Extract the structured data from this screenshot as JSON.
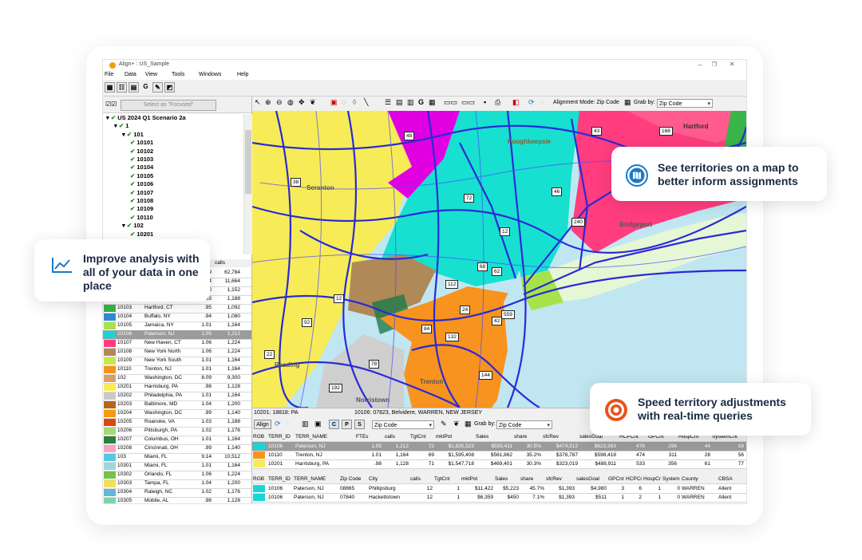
{
  "window": {
    "title": "Align+ : US_Sample",
    "menu": [
      "File",
      "Data",
      "View",
      "Tools",
      "Windows",
      "Help"
    ],
    "controls": [
      "–",
      "❐",
      "✕"
    ]
  },
  "left_panel": {
    "select_focused": "Select as \"Focused\"",
    "tree": [
      {
        "label": "US 2024 Q1 Scenario 2a",
        "level": 0
      },
      {
        "label": "1",
        "level": 1
      },
      {
        "label": "101",
        "level": 2
      },
      {
        "label": "10101",
        "level": 3
      },
      {
        "label": "10102",
        "level": 3
      },
      {
        "label": "10103",
        "level": 3
      },
      {
        "label": "10104",
        "level": 3
      },
      {
        "label": "10105",
        "level": 3
      },
      {
        "label": "10106",
        "level": 3
      },
      {
        "label": "10107",
        "level": 3
      },
      {
        "label": "10108",
        "level": 3
      },
      {
        "label": "10109",
        "level": 3
      },
      {
        "label": "10110",
        "level": 3
      },
      {
        "label": "102",
        "level": 2
      },
      {
        "label": "10201",
        "level": 3
      }
    ],
    "table_header": {
      "calls": "calls"
    },
    "rows": [
      {
        "id": "",
        "name": "",
        "ftes": "9",
        "calls": "62,784",
        "color": "#d8d8d8"
      },
      {
        "id": "",
        "name": "",
        "ftes": "4",
        "calls": "11,664",
        "color": "#d8d8d8"
      },
      {
        "id": "",
        "name": "",
        "ftes": "0",
        "calls": "1,152",
        "color": "#ffffff"
      },
      {
        "id": "",
        "name": "",
        "ftes": "03",
        "calls": "1,188",
        "color": "#ffffff"
      },
      {
        "id": "10103",
        "name": "Hartford, CT",
        "ftes": ".95",
        "calls": "1,092",
        "color": "#39b54a"
      },
      {
        "id": "10104",
        "name": "Buffalo, NY",
        "ftes": ".94",
        "calls": "1,080",
        "color": "#2e8bd0"
      },
      {
        "id": "10105",
        "name": "Jamaica, NY",
        "ftes": "1.01",
        "calls": "1,164",
        "color": "#a6e34a"
      },
      {
        "id": "10106",
        "name": "Paterson, NJ",
        "ftes": "1.05",
        "calls": "1,212",
        "color": "#17d6d6",
        "selected": true
      },
      {
        "id": "10107",
        "name": "New Haven, CT",
        "ftes": "1.06",
        "calls": "1,224",
        "color": "#ff3d7f"
      },
      {
        "id": "10108",
        "name": "New York North",
        "ftes": "1.06",
        "calls": "1,224",
        "color": "#b08958"
      },
      {
        "id": "10109",
        "name": "New York South",
        "ftes": "1.01",
        "calls": "1,164",
        "color": "#c7e84b"
      },
      {
        "id": "10110",
        "name": "Trenton, NJ",
        "ftes": "1.01",
        "calls": "1,164",
        "color": "#f7931e"
      },
      {
        "id": "102",
        "name": "Washington, DC",
        "ftes": "8.09",
        "calls": "9,300",
        "color": "#d9a066"
      },
      {
        "id": "10201",
        "name": "Harrisburg, PA",
        "ftes": ".98",
        "calls": "1,128",
        "color": "#f7ec57"
      },
      {
        "id": "10202",
        "name": "Philadelphia, PA",
        "ftes": "1.01",
        "calls": "1,164",
        "color": "#c9c9c9"
      },
      {
        "id": "10203",
        "name": "Baltimore, MD",
        "ftes": "1.04",
        "calls": "1,200",
        "color": "#b5651d"
      },
      {
        "id": "10204",
        "name": "Washington, DC",
        "ftes": ".99",
        "calls": "1,140",
        "color": "#f39c12"
      },
      {
        "id": "10205",
        "name": "Roanoke, VA",
        "ftes": "1.03",
        "calls": "1,188",
        "color": "#d9480f"
      },
      {
        "id": "10206",
        "name": "Pittsburgh, PA",
        "ftes": "1.02",
        "calls": "1,176",
        "color": "#a3d977"
      },
      {
        "id": "10207",
        "name": "Columbus, OH",
        "ftes": "1.01",
        "calls": "1,164",
        "color": "#2f7d3f"
      },
      {
        "id": "10208",
        "name": "Cincinnati, OH",
        "ftes": ".99",
        "calls": "1,140",
        "color": "#f6a5c0"
      },
      {
        "id": "103",
        "name": "Miami, FL",
        "ftes": "9.14",
        "calls": "10,512",
        "color": "#55c7e0"
      },
      {
        "id": "10301",
        "name": "Miami, FL",
        "ftes": "1.01",
        "calls": "1,164",
        "color": "#9fd7d7"
      },
      {
        "id": "10302",
        "name": "Orlando, FL",
        "ftes": "1.06",
        "calls": "1,224",
        "color": "#76c24a"
      },
      {
        "id": "10303",
        "name": "Tampa, FL",
        "ftes": "1.04",
        "calls": "1,200",
        "color": "#f1e05a"
      },
      {
        "id": "10304",
        "name": "Raleigh, NC",
        "ftes": "1.02",
        "calls": "1,176",
        "color": "#5fb8d8"
      },
      {
        "id": "10305",
        "name": "Mobile, AL",
        "ftes": ".98",
        "calls": "1,128",
        "color": "#7fd3a8"
      }
    ]
  },
  "map_toolbar": {
    "alignment_mode_label": "Alignment Mode: Zip Code",
    "grab_by_label": "Grab by:",
    "grab_by_value": "Zip Code"
  },
  "map": {
    "city_labels": [
      "Poughkeepsie",
      "Hartford",
      "Scranton",
      "Bridgeport",
      "Reading",
      "Trenton",
      "Norristown"
    ],
    "route_labels": [
      "48",
      "38",
      "72",
      "12",
      "68",
      "62",
      "42",
      "240",
      "24",
      "84",
      "132",
      "92",
      "78",
      "192",
      "22",
      "144",
      "559",
      "12",
      "112",
      "168",
      "43",
      "46"
    ]
  },
  "map_status": {
    "left": "10201: 18818: PA",
    "right": "10106: 07823, Belvidere, WARREN, NEW JERSEY"
  },
  "bottom_toolbar": {
    "align_label": "Align",
    "c_label": "C",
    "p_label": "P",
    "s_label": "S",
    "zip_combo": "Zip Code",
    "grab_by_label": "Grab by:",
    "grab_by_value": "Zip Code"
  },
  "terr_grid": {
    "headers": [
      "RGB",
      "TERR_ID",
      "TERR_NAME",
      "FTEs",
      "calls",
      "TgtCnt",
      "mktPot",
      "Sales",
      "share",
      "sfcRev",
      "salesGoal",
      "HCPCnt",
      "GPCnt",
      "HospCnt",
      "SystemCnt"
    ],
    "rows": [
      {
        "color": "#17d6d6",
        "cells": [
          "10106",
          "Paterson, NJ",
          "1.05",
          "1,212",
          "72",
          "$1,835,523",
          "$559,411",
          "30.5%",
          "$474,512",
          "$623,993",
          "476",
          "296",
          "44",
          "59"
        ],
        "selected": true
      },
      {
        "color": "#f7931e",
        "cells": [
          "10110",
          "Trenton, NJ",
          "1.01",
          "1,164",
          "69",
          "$1,595,408",
          "$561,862",
          "35.2%",
          "$378,787",
          "$598,418",
          "474",
          "311",
          "28",
          "56"
        ]
      },
      {
        "color": "#f7ec57",
        "cells": [
          "10201",
          "Harrisburg, PA",
          ".98",
          "1,128",
          "71",
          "$1,547,718",
          "$469,401",
          "30.3%",
          "$323,019",
          "$488,911",
          "533",
          "356",
          "61",
          "77"
        ]
      }
    ]
  },
  "zip_grid": {
    "headers": [
      "RGB",
      "TERR_ID",
      "TERR_NAME",
      "Zip Code",
      "City",
      "calls",
      "TgtCnt",
      "mktPot",
      "Sales",
      "share",
      "sfcRev",
      "salesGoal",
      "GPCnt",
      "HCPCnt",
      "HospCnt",
      "System",
      "County",
      "CBSA"
    ],
    "rows": [
      {
        "color": "#17d6d6",
        "cells": [
          "10106",
          "Paterson, NJ",
          "08865",
          "Phillipsburg",
          "12",
          "1",
          "$11,422",
          "$5,223",
          "45.7%",
          "$1,393",
          "$4,980",
          "3",
          "6",
          "1",
          "0",
          "WARREN",
          "Allent"
        ]
      },
      {
        "color": "#17d6d6",
        "cells": [
          "10106",
          "Paterson, NJ",
          "07840",
          "Hackettstown",
          "12",
          "1",
          "$6,359",
          "$450",
          "7.1%",
          "$1,393",
          "$511",
          "1",
          "2",
          "1",
          "0",
          "WARREN",
          "Allent"
        ]
      }
    ]
  },
  "callouts": {
    "map": "See territories on a map to better inform assignments",
    "analysis": "Improve analysis with all of your data in one place",
    "speed": "Speed territory adjustments with real-time queries"
  },
  "colors": {
    "accent_blue": "#1a79c9",
    "accent_orange": "#e8531b",
    "callout_text": "#1a2a44"
  }
}
